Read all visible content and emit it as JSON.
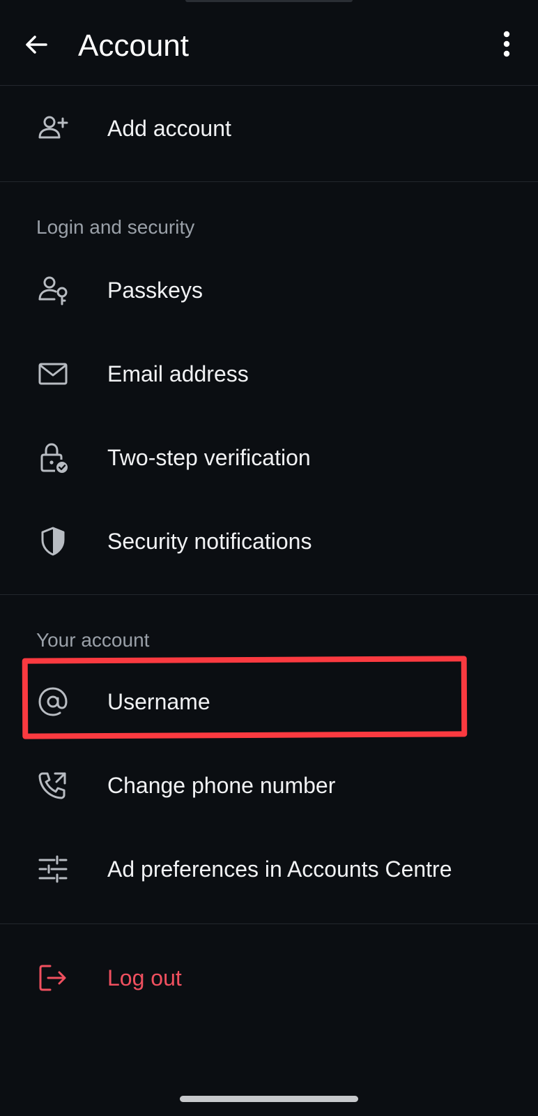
{
  "header": {
    "title": "Account",
    "back_icon": "arrow-left-icon",
    "more_icon": "more-vertical-icon"
  },
  "add_account": {
    "label": "Add account",
    "icon": "add-person-icon"
  },
  "login_security": {
    "section_title": "Login and security",
    "items": [
      {
        "label": "Passkeys",
        "icon": "person-key-icon"
      },
      {
        "label": "Email address",
        "icon": "envelope-icon"
      },
      {
        "label": "Two-step verification",
        "icon": "lock-check-icon"
      },
      {
        "label": "Security notifications",
        "icon": "shield-icon"
      }
    ]
  },
  "your_account": {
    "section_title": "Your account",
    "items": [
      {
        "label": "Username",
        "icon": "at-sign-icon"
      },
      {
        "label": "Change phone number",
        "icon": "phone-change-icon"
      },
      {
        "label": "Ad preferences in Accounts Centre",
        "icon": "sliders-icon"
      }
    ]
  },
  "logout": {
    "label": "Log out",
    "icon": "logout-icon"
  },
  "colors": {
    "background": "#0b0e12",
    "text": "#f1f2f4",
    "section_text": "#9aa0a8",
    "icon": "#b8bcc2",
    "logout": "#f0505f",
    "highlight": "#fb3a40"
  }
}
